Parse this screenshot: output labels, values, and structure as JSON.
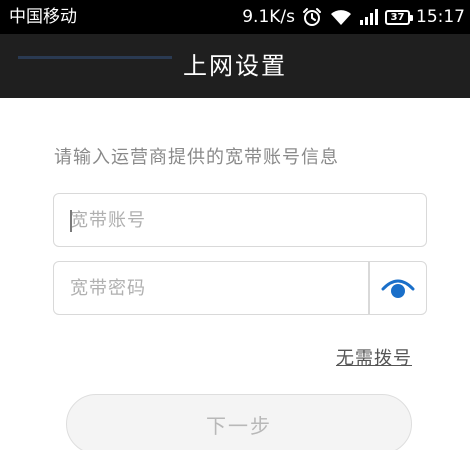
{
  "status_bar": {
    "carrier": "中国移动",
    "net_speed": "9.1K/s",
    "battery_level": "37",
    "time": "15:17",
    "icons": [
      "alarm-clock-icon",
      "wifi-icon",
      "signal-icon",
      "battery-icon"
    ]
  },
  "title_bar": {
    "title": "上网设置"
  },
  "form": {
    "instruction": "请输入运营商提供的宽带账号信息",
    "account": {
      "placeholder": "宽带账号",
      "value": ""
    },
    "password": {
      "placeholder": "宽带密码",
      "value": ""
    },
    "show_password_icon": "eye-icon",
    "no_dial_link": "无需拨号",
    "next_button": "下一步"
  },
  "colors": {
    "status_bg": "#000000",
    "title_bg": "#1f1f1f",
    "accent": "#1a6fc9",
    "hint_text": "#8a8a8a"
  }
}
